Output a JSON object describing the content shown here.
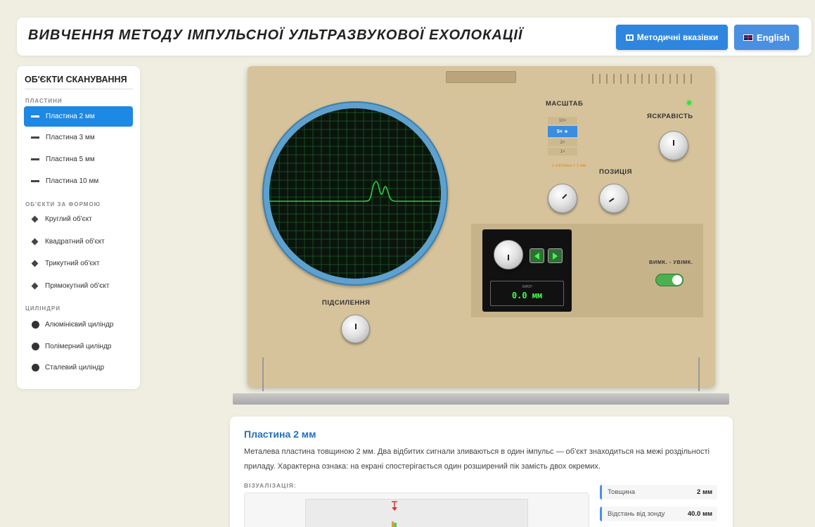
{
  "header": {
    "title": "ВИВЧЕННЯ МЕТОДУ ІМПУЛЬСНОЇ УЛЬТРАЗВУКОВОЇ ЕХОЛОКАЦІЇ",
    "guide_button": "Методичні вказівки",
    "lang_button": "English"
  },
  "sidebar": {
    "title": "ОБ'ЄКТИ СКАНУВАННЯ",
    "sections": [
      {
        "label": "ПЛАСТИНИ",
        "items": [
          "Пластина 2 мм",
          "Пластина 3 мм",
          "Пластина 5 мм",
          "Пластина 10 мм"
        ]
      },
      {
        "label": "ОБ'ЄКТИ ЗА ФОРМОЮ",
        "items": [
          "Круглий об'єкт",
          "Квадратний об'єкт",
          "Трикутний об'єкт",
          "Прямокутний об'єкт"
        ]
      },
      {
        "label": "ЦИЛІНДРИ",
        "items": [
          "Алюмінієвий циліндр",
          "Полімерний циліндр",
          "Сталевий циліндр"
        ]
      }
    ],
    "active_item": "Пластина 2 мм"
  },
  "device": {
    "scale_label": "МАСШТАБ",
    "scale_options": [
      "10×",
      "5× ★",
      "2×",
      "1×"
    ],
    "scale_selected": "5× ★",
    "scale_note": "1 клітинка = 1 мм",
    "brightness_label": "ЯСКРАВІСТЬ",
    "position_label": "ПОЗИЦІЯ",
    "gain_label": "ПІДСИЛЕННЯ",
    "power_label": "ВИМК. - УВІМК.",
    "power_on": true,
    "meter_label": "ЗАМІР",
    "meter_value": "0.0 мм",
    "led_color": "#2ee53a"
  },
  "info": {
    "title": "Пластина 2 мм",
    "description": "Металева пластина товщиною 2 мм. Два відбитих сигнали зливаються в один імпульс — об'єкт знаходиться на межі роздільності приладу. Характерна ознака: на екрані спостерігається один розширений пік замість двох окремих.",
    "viz_label": "ВІЗУАЛІЗАЦІЯ:",
    "properties": [
      {
        "key": "Товщина",
        "value": "2 мм"
      },
      {
        "key": "Відстань від зонду",
        "value": "40.0 мм"
      }
    ]
  },
  "colors": {
    "accent": "#1e88e5",
    "device_body": "#d7c39b",
    "screen_trace": "#2ecc40"
  }
}
